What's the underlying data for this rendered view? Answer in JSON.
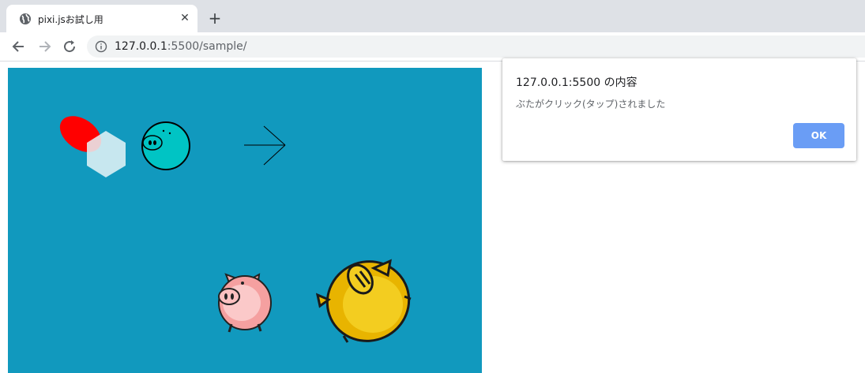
{
  "browser": {
    "tab": {
      "title": "pixi.jsお試し用",
      "icon": "globe-icon",
      "close_label": "✕"
    },
    "new_tab_label": "+",
    "toolbar": {
      "back_icon": "back-arrow-icon",
      "forward_icon": "forward-arrow-icon",
      "reload_icon": "reload-icon",
      "info_icon": "info-icon",
      "url_host": "127.0.0.1",
      "url_rest": ":5500/sample/"
    }
  },
  "canvas": {
    "background": "#1199be",
    "sprites": [
      "red-ellipse",
      "white-hexagon",
      "teal-pig-face-circle",
      "arrow-lines",
      "pink-pig",
      "yellow-pig"
    ]
  },
  "dialog": {
    "title": "127.0.0.1:5500 の内容",
    "message": "ぶたがクリック(タップ)されました",
    "ok_label": "OK",
    "ok_color": "#6a9df5"
  }
}
